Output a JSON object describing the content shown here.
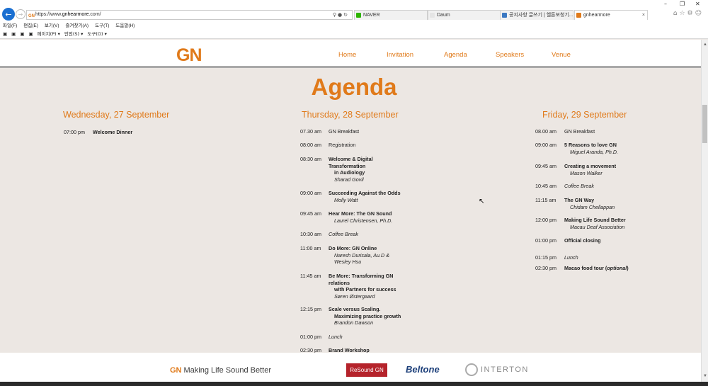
{
  "browser": {
    "back_icon": "arrow-left-icon",
    "address": {
      "favicon": "GN",
      "url_prefix": "https://www.",
      "url_host": "gnhearmore",
      "url_suffix": ".com/"
    },
    "tabs": [
      {
        "label": "NAVER",
        "color": "#2db400"
      },
      {
        "label": "Daum",
        "color": "#e5e5e5"
      },
      {
        "label": "공지사항 글쓰기 | 헬튼보청기...",
        "color": "#3a78c2"
      },
      {
        "label": "gnhearmore",
        "color": "#e07a1a"
      }
    ],
    "menu": [
      "파일(F)",
      "편집(E)",
      "보기(V)",
      "즐겨찾기(A)",
      "도구(T)",
      "도움말(H)"
    ],
    "commands": [
      "페이지(P) ▾",
      "안전(S) ▾",
      "도구(O) ▾"
    ]
  },
  "site": {
    "logo": "GN",
    "nav": [
      "Home",
      "Invitation",
      "Agenda",
      "Speakers",
      "Venue"
    ],
    "title": "Agenda",
    "days": [
      {
        "heading": "Wednesday, 27 September",
        "events": [
          {
            "time": "07:00 pm",
            "lines": [
              {
                "text": "Welcome Dinner",
                "style": "title"
              }
            ]
          }
        ]
      },
      {
        "heading": "Thursday, 28 September",
        "events": [
          {
            "time": "07.30 am",
            "lines": [
              {
                "text": "GN Breakfast",
                "style": "plain"
              }
            ]
          },
          {
            "time": "08:00 am",
            "lines": [
              {
                "text": "Registration",
                "style": "plain"
              }
            ]
          },
          {
            "time": "08:30 am",
            "lines": [
              {
                "text": "Welcome & Digital Transformation",
                "style": "title"
              },
              {
                "text": "in Audiology",
                "style": "title"
              },
              {
                "text": "Sharad Govil",
                "style": "sub"
              }
            ]
          },
          {
            "time": "09:00 am",
            "lines": [
              {
                "text": "Succeeding Against the Odds",
                "style": "title"
              },
              {
                "text": "Molly Watt",
                "style": "sub"
              }
            ]
          },
          {
            "time": "09:45 am",
            "lines": [
              {
                "text": "Hear More: The GN Sound",
                "style": "title"
              },
              {
                "text": "Laurel Christensen, Ph.D.",
                "style": "sub"
              }
            ]
          },
          {
            "time": "10:30 am",
            "lines": [
              {
                "text": "Coffee Break",
                "style": "sub"
              }
            ]
          },
          {
            "time": "11:00 am",
            "lines": [
              {
                "text": "Do More: GN Online",
                "style": "title"
              },
              {
                "text": "Naresh Durisala, Au.D &",
                "style": "sub"
              },
              {
                "text": "Wesley Hsu",
                "style": "sub"
              }
            ]
          },
          {
            "time": "11:45 am",
            "lines": [
              {
                "text": "Be More: Transforming GN relations",
                "style": "title"
              },
              {
                "text": "with Partners for success",
                "style": "title"
              },
              {
                "text": "Søren Østergaard",
                "style": "sub"
              }
            ]
          },
          {
            "time": "12:15 pm",
            "lines": [
              {
                "text": "Scale versus Scaling.",
                "style": "title"
              },
              {
                "text": "Maximizing practice growth",
                "style": "title"
              },
              {
                "text": "Brandon Dawson",
                "style": "sub"
              }
            ]
          },
          {
            "time": "01:00 pm",
            "lines": [
              {
                "text": "Lunch",
                "style": "sub"
              }
            ]
          },
          {
            "time": "02:30 pm",
            "lines": [
              {
                "text": "Brand Workshop",
                "style": "title"
              }
            ]
          }
        ]
      },
      {
        "heading": "Friday, 29 September",
        "events": [
          {
            "time": "08.00 am",
            "lines": [
              {
                "text": "GN Breakfast",
                "style": "plain"
              }
            ]
          },
          {
            "time": "09:00 am",
            "lines": [
              {
                "text": "5 Reasons to love GN",
                "style": "title"
              },
              {
                "text": "Miguel Aranda, Ph.D.",
                "style": "sub"
              }
            ]
          },
          {
            "time": "09:45 am",
            "lines": [
              {
                "text": "Creating a movement",
                "style": "title"
              },
              {
                "text": "Mason Walker",
                "style": "sub"
              }
            ]
          },
          {
            "time": "10:45 am",
            "lines": [
              {
                "text": "Coffee Break",
                "style": "sub"
              }
            ]
          },
          {
            "time": "11:15 am",
            "lines": [
              {
                "text": "The GN Way",
                "style": "title"
              },
              {
                "text": "Chidam Chellappan",
                "style": "sub"
              }
            ]
          },
          {
            "time": "12:00 pm",
            "lines": [
              {
                "text": "Making Life Sound Better",
                "style": "title"
              },
              {
                "text": "Macau Deaf Association",
                "style": "sub"
              }
            ]
          },
          {
            "time": "01:00 pm",
            "lines": [
              {
                "text": "Official closing",
                "style": "title"
              }
            ]
          },
          {
            "time": "01:15 pm",
            "lines": [
              {
                "text": "Lunch",
                "style": "sub"
              }
            ]
          },
          {
            "time": "02:30 pm",
            "lines": [
              {
                "text": "Macao food tour (",
                "style": "title"
              },
              {
                "text": "optional",
                "style": "title-italic"
              },
              {
                "text": ")",
                "style": "title"
              }
            ]
          }
        ]
      }
    ],
    "footer": {
      "gn": "GN",
      "tagline": "Making Life Sound Better",
      "resound": "ReSound GN",
      "beltone": "Beltone",
      "interton": "INTERTON"
    }
  },
  "colors": {
    "accent": "#e07a1a",
    "page_bg": "#ece7e3",
    "resound": "#b5232b",
    "beltone": "#1c3f7a"
  }
}
